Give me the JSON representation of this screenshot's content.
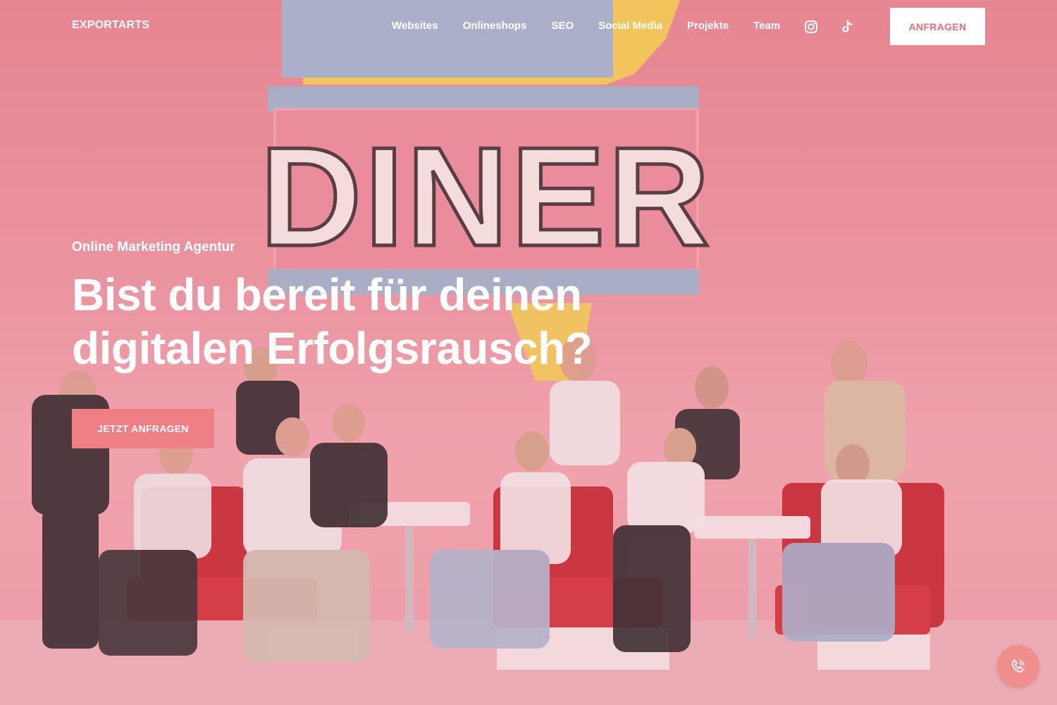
{
  "brand": {
    "name": "EXPORTARTS"
  },
  "nav": {
    "items": [
      {
        "label": "Websites"
      },
      {
        "label": "Onlineshops"
      },
      {
        "label": "SEO"
      },
      {
        "label": "Social Media"
      },
      {
        "label": "Projekte"
      },
      {
        "label": "Team"
      }
    ],
    "social": [
      {
        "icon": "instagram-icon"
      },
      {
        "icon": "tiktok-icon"
      }
    ],
    "cta_label": "ANFRAGEN"
  },
  "hero": {
    "eyebrow": "Online Marketing Agentur",
    "headline_line1": "Bist du bereit für deinen",
    "headline_line2": "digitalen Erfolgsrausch?",
    "cta_label": "JETZT ANFRAGEN",
    "sign_text": "DINER"
  },
  "chat": {
    "icon": "phone-icon"
  },
  "colors": {
    "accent": "#ee7f85",
    "accent_text": "#e56e7a",
    "background": "#ea95a0",
    "white": "#ffffff"
  }
}
